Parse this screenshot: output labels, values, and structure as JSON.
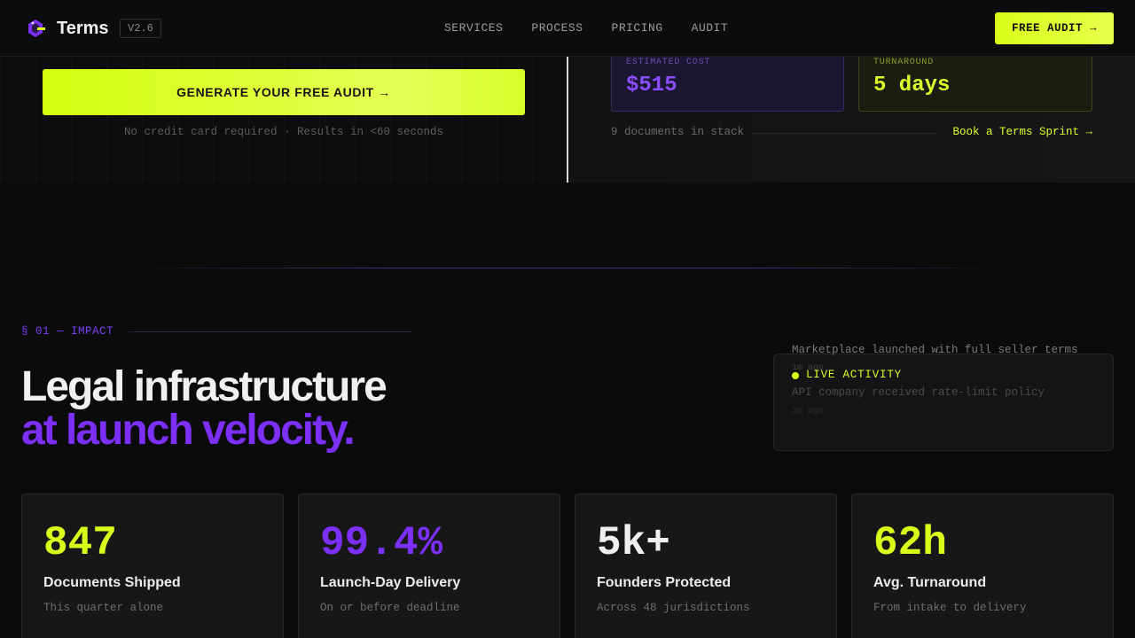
{
  "header": {
    "brand": "Terms",
    "version": "V2.6",
    "nav": [
      "SERVICES",
      "PROCESS",
      "PRICING",
      "AUDIT"
    ],
    "cta": "FREE AUDIT →"
  },
  "hero": {
    "generate_button": "GENERATE YOUR FREE AUDIT →",
    "note": "No credit card required · Results in <60 seconds",
    "cost": {
      "label": "ESTIMATED COST",
      "value": "$515"
    },
    "turnaround": {
      "label": "TURNAROUND",
      "value": "5 days"
    },
    "docs": "9 documents in stack",
    "sprint_link": "Book a Terms Sprint →"
  },
  "impact": {
    "eyebrow": "§ 01 — IMPACT",
    "headline_1": "Legal infrastructure",
    "headline_2": "at launch velocity."
  },
  "live": {
    "title": "LIVE ACTIVITY",
    "feed": [
      {
        "text": "Marketplace launched with full seller terms",
        "time": "1m ago"
      },
      {
        "text": "API company received rate-limit policy",
        "time": "3m ago"
      }
    ]
  },
  "stats": [
    {
      "value": "847",
      "title": "Documents Shipped",
      "sub": "This quarter alone",
      "color": "#d8ff1a"
    },
    {
      "value": "99.4%",
      "title": "Launch-Day Delivery",
      "sub": "On or before deadline",
      "color": "#7b2ff7"
    },
    {
      "value": "5k+",
      "title": "Founders Protected",
      "sub": "Across 48 jurisdictions",
      "color": "#f0f0f0"
    },
    {
      "value": "62h",
      "title": "Avg. Turnaround",
      "sub": "From intake to delivery",
      "color": "#d8ff1a"
    }
  ]
}
